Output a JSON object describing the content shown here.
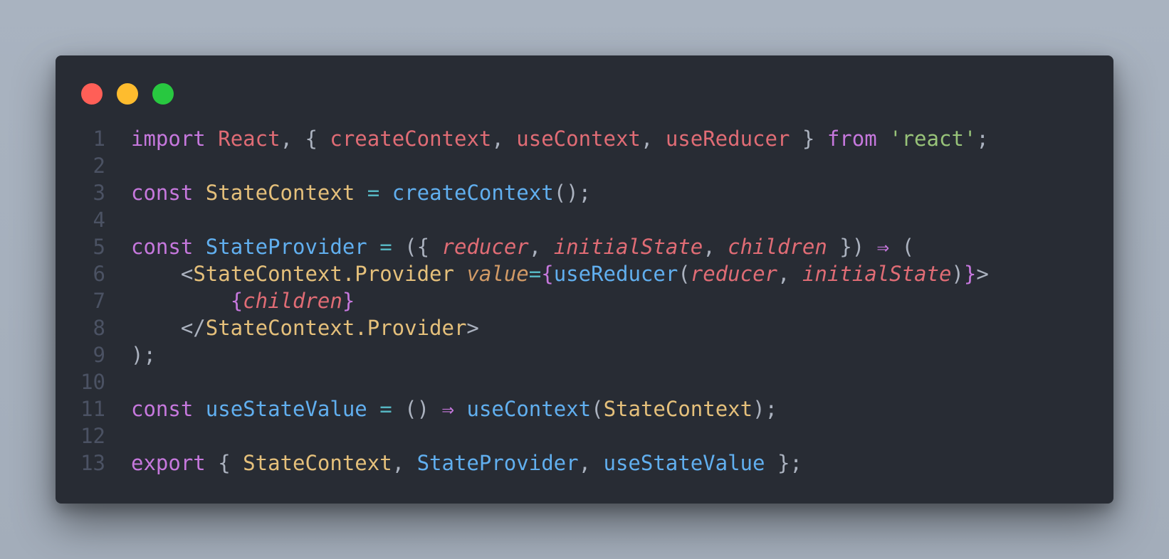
{
  "window": {
    "traffic_lights": [
      {
        "name": "close",
        "color": "#ff5f57"
      },
      {
        "name": "minimize",
        "color": "#febc2e"
      },
      {
        "name": "maximize",
        "color": "#28c840"
      }
    ]
  },
  "colors": {
    "background": "#a6b0bd",
    "editor": "#282c34",
    "line_number": "#4b5263",
    "keyword": "#c678dd",
    "variable": "#e06c75",
    "function": "#61afef",
    "class": "#e5c07b",
    "string": "#98c379",
    "operator": "#56b6c2",
    "punctuation": "#abb2bf",
    "attribute": "#d19a66"
  },
  "code": {
    "lines": [
      {
        "number": "1",
        "tokens": [
          {
            "t": "import",
            "c": "keyword"
          },
          {
            "t": " ",
            "c": "punctuation"
          },
          {
            "t": "React",
            "c": "variable"
          },
          {
            "t": ", { ",
            "c": "punctuation"
          },
          {
            "t": "createContext",
            "c": "variable"
          },
          {
            "t": ", ",
            "c": "punctuation"
          },
          {
            "t": "useContext",
            "c": "variable"
          },
          {
            "t": ", ",
            "c": "punctuation"
          },
          {
            "t": "useReducer",
            "c": "variable"
          },
          {
            "t": " } ",
            "c": "punctuation"
          },
          {
            "t": "from",
            "c": "keyword"
          },
          {
            "t": " ",
            "c": "punctuation"
          },
          {
            "t": "'react'",
            "c": "string"
          },
          {
            "t": ";",
            "c": "punctuation"
          }
        ]
      },
      {
        "number": "2",
        "tokens": []
      },
      {
        "number": "3",
        "tokens": [
          {
            "t": "const",
            "c": "keyword"
          },
          {
            "t": " ",
            "c": "punctuation"
          },
          {
            "t": "StateContext",
            "c": "class"
          },
          {
            "t": " ",
            "c": "punctuation"
          },
          {
            "t": "=",
            "c": "operator"
          },
          {
            "t": " ",
            "c": "punctuation"
          },
          {
            "t": "createContext",
            "c": "function"
          },
          {
            "t": "();",
            "c": "punctuation"
          }
        ]
      },
      {
        "number": "4",
        "tokens": []
      },
      {
        "number": "5",
        "tokens": [
          {
            "t": "const",
            "c": "keyword"
          },
          {
            "t": " ",
            "c": "punctuation"
          },
          {
            "t": "StateProvider",
            "c": "function"
          },
          {
            "t": " ",
            "c": "punctuation"
          },
          {
            "t": "=",
            "c": "operator"
          },
          {
            "t": " ({ ",
            "c": "punctuation"
          },
          {
            "t": "reducer",
            "c": "variable",
            "italic": true
          },
          {
            "t": ", ",
            "c": "punctuation"
          },
          {
            "t": "initialState",
            "c": "variable",
            "italic": true
          },
          {
            "t": ", ",
            "c": "punctuation"
          },
          {
            "t": "children",
            "c": "variable",
            "italic": true
          },
          {
            "t": " }) ",
            "c": "punctuation"
          },
          {
            "t": "⇒",
            "c": "keyword"
          },
          {
            "t": " (",
            "c": "punctuation"
          }
        ]
      },
      {
        "number": "6",
        "tokens": [
          {
            "t": "    <",
            "c": "punctuation"
          },
          {
            "t": "StateContext.Provider",
            "c": "class"
          },
          {
            "t": " ",
            "c": "punctuation"
          },
          {
            "t": "value",
            "c": "attribute",
            "italic": true
          },
          {
            "t": "=",
            "c": "operator"
          },
          {
            "t": "{",
            "c": "keyword"
          },
          {
            "t": "useReducer",
            "c": "function"
          },
          {
            "t": "(",
            "c": "punctuation"
          },
          {
            "t": "reducer",
            "c": "variable",
            "italic": true
          },
          {
            "t": ", ",
            "c": "punctuation"
          },
          {
            "t": "initialState",
            "c": "variable",
            "italic": true
          },
          {
            "t": ")",
            "c": "punctuation"
          },
          {
            "t": "}",
            "c": "keyword"
          },
          {
            "t": ">",
            "c": "punctuation"
          }
        ]
      },
      {
        "number": "7",
        "tokens": [
          {
            "t": "        ",
            "c": "punctuation"
          },
          {
            "t": "{",
            "c": "keyword"
          },
          {
            "t": "children",
            "c": "variable",
            "italic": true
          },
          {
            "t": "}",
            "c": "keyword"
          }
        ]
      },
      {
        "number": "8",
        "tokens": [
          {
            "t": "    </",
            "c": "punctuation"
          },
          {
            "t": "StateContext.Provider",
            "c": "class"
          },
          {
            "t": ">",
            "c": "punctuation"
          }
        ]
      },
      {
        "number": "9",
        "tokens": [
          {
            "t": ");",
            "c": "punctuation"
          }
        ]
      },
      {
        "number": "10",
        "tokens": []
      },
      {
        "number": "11",
        "tokens": [
          {
            "t": "const",
            "c": "keyword"
          },
          {
            "t": " ",
            "c": "punctuation"
          },
          {
            "t": "useStateValue",
            "c": "function"
          },
          {
            "t": " ",
            "c": "punctuation"
          },
          {
            "t": "=",
            "c": "operator"
          },
          {
            "t": " () ",
            "c": "punctuation"
          },
          {
            "t": "⇒",
            "c": "keyword"
          },
          {
            "t": " ",
            "c": "punctuation"
          },
          {
            "t": "useContext",
            "c": "function"
          },
          {
            "t": "(",
            "c": "punctuation"
          },
          {
            "t": "StateContext",
            "c": "class"
          },
          {
            "t": ");",
            "c": "punctuation"
          }
        ]
      },
      {
        "number": "12",
        "tokens": []
      },
      {
        "number": "13",
        "tokens": [
          {
            "t": "export",
            "c": "keyword"
          },
          {
            "t": " { ",
            "c": "punctuation"
          },
          {
            "t": "StateContext",
            "c": "class"
          },
          {
            "t": ", ",
            "c": "punctuation"
          },
          {
            "t": "StateProvider",
            "c": "function"
          },
          {
            "t": ", ",
            "c": "punctuation"
          },
          {
            "t": "useStateValue",
            "c": "function"
          },
          {
            "t": " };",
            "c": "punctuation"
          }
        ]
      }
    ]
  }
}
